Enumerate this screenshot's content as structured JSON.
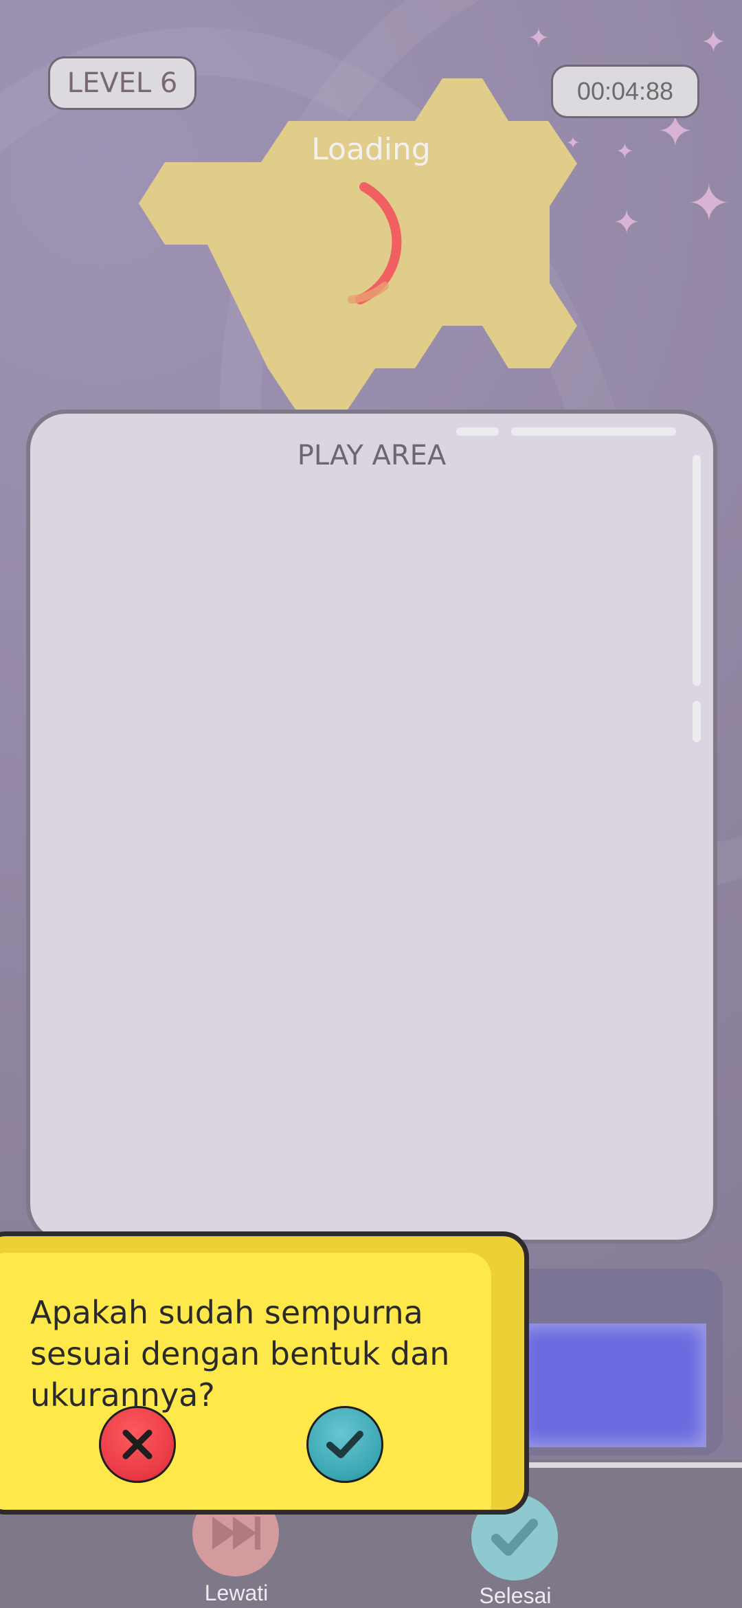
{
  "header": {
    "level_label": "LEVEL 6",
    "timer_text": "00:04:88"
  },
  "loading": {
    "label": "Loading"
  },
  "play_area": {
    "title": "PLAY AREA"
  },
  "controls": {
    "skip_label": "Lewati",
    "done_label": "Selesai",
    "skip_icon": "fast-forward-icon",
    "done_icon": "check-icon"
  },
  "confirm_dialog": {
    "question": "Apakah sudah sempurna sesuai dengan bentuk dan ukurannya?",
    "no_icon": "close-icon",
    "yes_icon": "check-icon"
  },
  "colors": {
    "shape": "#e0cd8a",
    "dialog": "#ffe84a",
    "spinner": "#f06060",
    "accent_blue": "#6a6adf"
  }
}
